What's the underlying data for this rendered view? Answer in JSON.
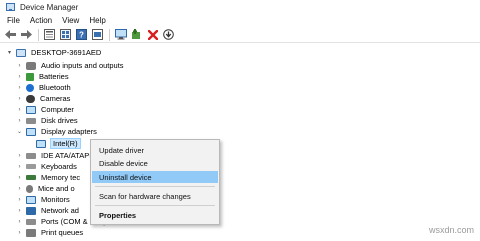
{
  "window": {
    "title": "Device Manager"
  },
  "menubar": {
    "items": [
      "File",
      "Action",
      "View",
      "Help"
    ]
  },
  "toolbar": {
    "icons": [
      "back-arrow-icon",
      "forward-arrow-icon",
      "properties-icon",
      "show-hidden-icon",
      "help-icon",
      "action-icon",
      "monitor-scan-icon",
      "add-driver-icon",
      "uninstall-x-icon",
      "download-update-icon"
    ]
  },
  "tree": {
    "root": "DESKTOP-3691AED",
    "items": [
      {
        "label": "Audio inputs and outputs",
        "icon": "speaker-icon",
        "expanded": false
      },
      {
        "label": "Batteries",
        "icon": "battery-icon",
        "expanded": false
      },
      {
        "label": "Bluetooth",
        "icon": "bluetooth-icon",
        "expanded": false
      },
      {
        "label": "Cameras",
        "icon": "camera-icon",
        "expanded": false
      },
      {
        "label": "Computer",
        "icon": "computer-icon",
        "expanded": false
      },
      {
        "label": "Disk drives",
        "icon": "disk-icon",
        "expanded": false
      },
      {
        "label": "Display adapters",
        "icon": "display-adapter-icon",
        "expanded": true
      },
      {
        "label": "Intel(R)",
        "icon": "display-adapter-icon",
        "child": true,
        "selected": true
      },
      {
        "label": "IDE ATA/ATAPI",
        "icon": "ide-icon",
        "expanded": false
      },
      {
        "label": "Keyboards",
        "icon": "keyboard-icon",
        "expanded": false
      },
      {
        "label": "Memory tec",
        "icon": "memory-icon",
        "expanded": false
      },
      {
        "label": "Mice and o",
        "icon": "mouse-icon",
        "expanded": false
      },
      {
        "label": "Monitors",
        "icon": "monitor-icon",
        "expanded": false
      },
      {
        "label": "Network ad",
        "icon": "network-icon",
        "expanded": false
      },
      {
        "label": "Ports (COM & LPT)",
        "icon": "port-icon",
        "expanded": false
      },
      {
        "label": "Print queues",
        "icon": "printer-icon",
        "expanded": false
      }
    ]
  },
  "context_menu": {
    "items": [
      {
        "label": "Update driver",
        "highlight": false,
        "bold": false
      },
      {
        "label": "Disable device",
        "highlight": false,
        "bold": false
      },
      {
        "label": "Uninstall device",
        "highlight": true,
        "bold": false
      },
      {
        "label": "Scan for hardware changes",
        "highlight": false,
        "bold": false
      },
      {
        "label": "Properties",
        "highlight": false,
        "bold": true
      }
    ]
  },
  "watermark": "wsxdn.com",
  "colors": {
    "highlight": "#91c9f7",
    "selection": "#cde8ff",
    "accent": "#3a6fb0",
    "delete": "#d81e1e"
  }
}
